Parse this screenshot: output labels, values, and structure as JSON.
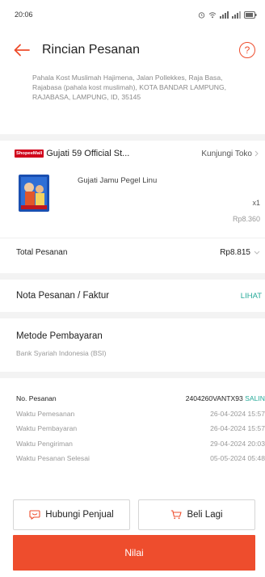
{
  "status_bar": {
    "time": "20:06"
  },
  "header": {
    "title": "Rincian Pesanan",
    "help_glyph": "?"
  },
  "address": {
    "text": "Pahala Kost Muslimah Hajimena, Jalan Pollekkes, Raja Basa, Rajabasa (pahala kost muslimah), KOTA BANDAR LAMPUNG, RAJABASA, LAMPUNG, ID, 35145"
  },
  "shop": {
    "badge": "ShopeeMall",
    "name": "Gujati 59 Official St...",
    "visit_label": "Kunjungi Toko",
    "product": {
      "name": "Gujati Jamu Pegel Linu",
      "quantity": "x1",
      "price": "Rp8.360"
    },
    "total_label": "Total Pesanan",
    "total_value": "Rp8.815"
  },
  "invoice": {
    "label": "Nota Pesanan / Faktur",
    "link": "LIHAT"
  },
  "payment": {
    "title": "Metode Pembayaran",
    "method": "Bank Syariah Indonesia (BSI)"
  },
  "order": {
    "number_label": "No. Pesanan",
    "number_value": "2404260VANTX93",
    "copy_label": "SALIN",
    "rows": [
      {
        "label": "Waktu Pemesanan",
        "value": "26-04-2024 15:57"
      },
      {
        "label": "Waktu Pembayaran",
        "value": "26-04-2024 15:57"
      },
      {
        "label": "Waktu Pengiriman",
        "value": "29-04-2024 20:03"
      },
      {
        "label": "Waktu Pesanan Selesai",
        "value": "05-05-2024 05:48"
      }
    ]
  },
  "actions": {
    "contact_seller": "Hubungi Penjual",
    "buy_again": "Beli Lagi",
    "rate": "Nilai"
  },
  "colors": {
    "accent": "#ee4d2d",
    "link": "#26aa99",
    "mall_badge": "#d0011b"
  }
}
